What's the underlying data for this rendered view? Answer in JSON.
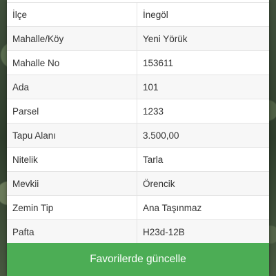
{
  "details": {
    "rows": [
      {
        "label": "İlçe",
        "value": "İnegöl"
      },
      {
        "label": "Mahalle/Köy",
        "value": "Yeni Yörük"
      },
      {
        "label": "Mahalle No",
        "value": "153611"
      },
      {
        "label": "Ada",
        "value": "101"
      },
      {
        "label": "Parsel",
        "value": "1233"
      },
      {
        "label": "Tapu Alanı",
        "value": "3.500,00"
      },
      {
        "label": "Nitelik",
        "value": "Tarla"
      },
      {
        "label": "Mevkii",
        "value": "Örencik"
      },
      {
        "label": "Zemin Tip",
        "value": "Ana Taşınmaz"
      },
      {
        "label": "Pafta",
        "value": "H23d-12B"
      }
    ]
  },
  "actions": {
    "update_favorites_label": "Favorilerde güncelle"
  },
  "colors": {
    "button_green": "#4cad55",
    "panel_bg": "#ffffff"
  }
}
